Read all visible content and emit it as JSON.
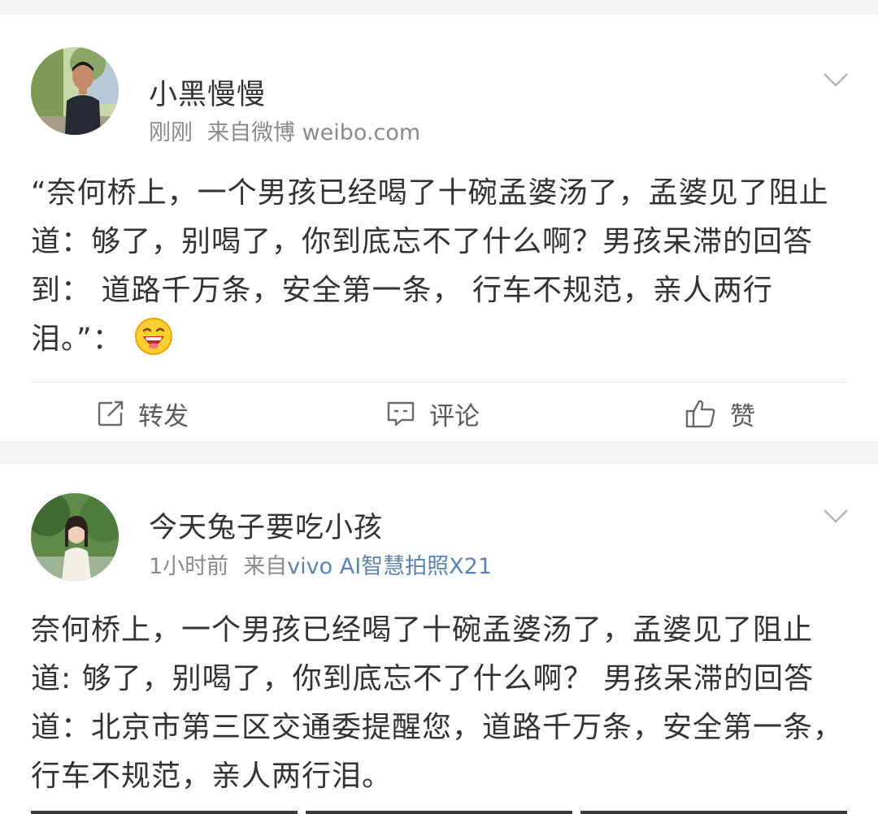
{
  "posts": [
    {
      "username": "小黑慢慢",
      "time": "刚刚",
      "source_prefix": "来自微博",
      "source_name": "weibo.com",
      "text": "“奈何桥上，一个男孩已经喝了十碗孟婆汤了，孟婆见了阻止道：够了，别喝了，你到底忘不了什么啊？男孩呆滞的回答到： 道路千万条，安全第一条， 行车不规范，亲人两行泪。”：",
      "emoji": "grinning-face-emoji",
      "actions": {
        "repost": "转发",
        "comment": "评论",
        "like": "赞"
      }
    },
    {
      "username": "今天兔子要吃小孩",
      "time": "1小时前",
      "source_prefix": "来自",
      "source_name": "vivo AI智慧拍照X21",
      "text": "奈何桥上，一个男孩已经喝了十碗孟婆汤了，孟婆见了阻止道: 够了，别喝了，你到底忘不了什么啊？ 男孩呆滞的回答道：北京市第三区交通委提醒您，道路千万条，安全第一条，行车不规范，亲人两行泪。"
    }
  ],
  "colors": {
    "background": "#f2f2f2",
    "card": "#ffffff",
    "text": "#333333",
    "meta": "#8a8a8a",
    "link": "#5b84b0"
  }
}
